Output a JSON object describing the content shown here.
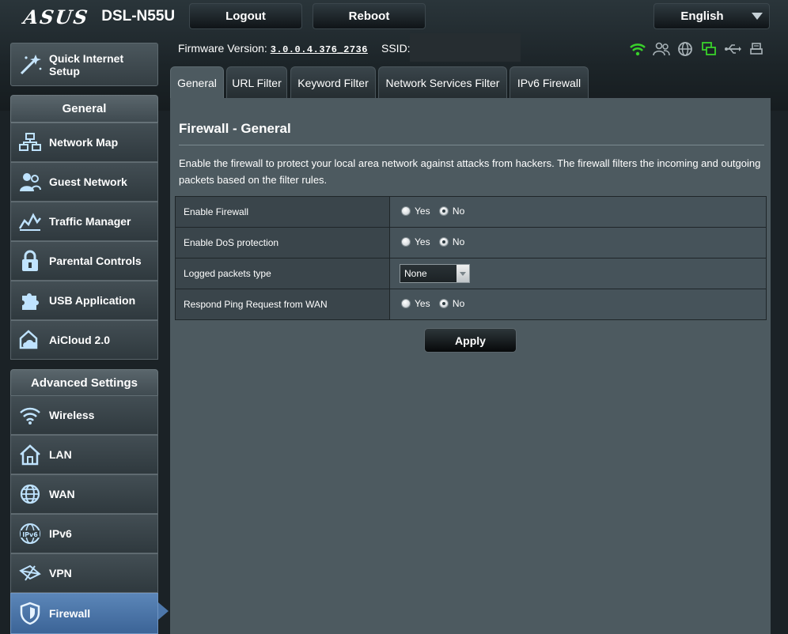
{
  "header": {
    "brand": "ASUS",
    "model": "DSL-N55U",
    "logout": "Logout",
    "reboot": "Reboot",
    "language": "English"
  },
  "status": {
    "firmware_label": "Firmware Version:",
    "firmware_value": "3.0.0.4.376_2736",
    "ssid_label": "SSID:",
    "icons": [
      "wifi-icon",
      "clients-icon",
      "internet-globe-icon",
      "network-status-icon",
      "usb-icon",
      "printer-icon"
    ]
  },
  "sidebar": {
    "quick_setup": "Quick Internet Setup",
    "general_title": "General",
    "general_items": [
      {
        "label": "Network Map",
        "icon": "network-map-icon"
      },
      {
        "label": "Guest Network",
        "icon": "guest-network-icon"
      },
      {
        "label": "Traffic Manager",
        "icon": "traffic-manager-icon"
      },
      {
        "label": "Parental Controls",
        "icon": "parental-lock-icon"
      },
      {
        "label": "USB Application",
        "icon": "puzzle-icon"
      },
      {
        "label": "AiCloud 2.0",
        "icon": "cloud-icon"
      }
    ],
    "advanced_title": "Advanced Settings",
    "advanced_items": [
      {
        "label": "Wireless",
        "icon": "wireless-icon"
      },
      {
        "label": "LAN",
        "icon": "house-icon"
      },
      {
        "label": "WAN",
        "icon": "globe-icon"
      },
      {
        "label": "IPv6",
        "icon": "ipv6-icon"
      },
      {
        "label": "VPN",
        "icon": "vpn-icon"
      },
      {
        "label": "Firewall",
        "icon": "shield-icon"
      }
    ],
    "active_item": "Firewall"
  },
  "tabs": [
    {
      "label": "General",
      "active": true
    },
    {
      "label": "URL Filter",
      "active": false
    },
    {
      "label": "Keyword Filter",
      "active": false
    },
    {
      "label": "Network Services Filter",
      "active": false
    },
    {
      "label": "IPv6 Firewall",
      "active": false
    }
  ],
  "main": {
    "title": "Firewall - General",
    "description": "Enable the firewall to protect your local area network against attacks from hackers. The firewall filters the incoming and outgoing packets based on the filter rules.",
    "yes": "Yes",
    "no": "No",
    "rows": [
      {
        "label": "Enable Firewall",
        "type": "radio",
        "value": "No"
      },
      {
        "label": "Enable DoS protection",
        "type": "radio",
        "value": "No"
      },
      {
        "label": "Logged packets type",
        "type": "select",
        "value": "None"
      },
      {
        "label": "Respond Ping Request from WAN",
        "type": "radio",
        "value": "No"
      }
    ],
    "apply": "Apply"
  },
  "colors": {
    "active_item": "#4d77aa",
    "status_icon_green": "#39d12b",
    "panel": "#4d5a60"
  }
}
